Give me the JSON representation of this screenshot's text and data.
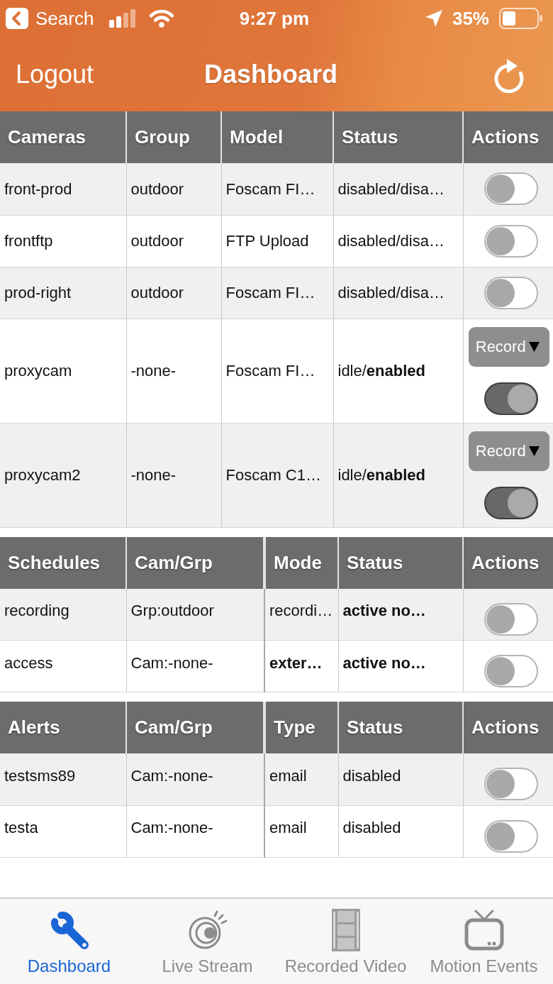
{
  "status_bar": {
    "back_label": "Search",
    "time": "9:27 pm",
    "battery": "35%"
  },
  "nav_bar": {
    "left_button": "Logout",
    "title": "Dashboard"
  },
  "tables": [
    {
      "kind": "cameras",
      "columns": [
        "Cameras",
        "Group",
        "Model",
        "Status",
        "Actions"
      ],
      "rows": [
        {
          "cells": [
            {
              "text": "front-prod",
              "bold": false
            },
            {
              "text": "outdoor",
              "bold": false
            },
            {
              "text": "Foscam FI…",
              "bold": false
            },
            {
              "text": "disabled/disa…",
              "bold": false
            }
          ],
          "on": false
        },
        {
          "cells": [
            {
              "text": "frontftp",
              "bold": false
            },
            {
              "text": "outdoor",
              "bold": false
            },
            {
              "text": "FTP Upload",
              "bold": false
            },
            {
              "text": "disabled/disa…",
              "bold": false
            }
          ],
          "on": false
        },
        {
          "cells": [
            {
              "text": "prod-right",
              "bold": false
            },
            {
              "text": "outdoor",
              "bold": false
            },
            {
              "text": "Foscam FI…",
              "bold": false
            },
            {
              "text": "disabled/disa…",
              "bold": false
            }
          ],
          "on": false
        },
        {
          "cells": [
            {
              "text": "proxycam",
              "bold": false
            },
            {
              "text": "-none-",
              "bold": false
            },
            {
              "text": "Foscam FI…",
              "bold": false
            },
            {
              "text": "idle/**enabled**",
              "bold": false
            }
          ],
          "record_button": "Record",
          "on": true
        },
        {
          "cells": [
            {
              "text": "proxycam2",
              "bold": false
            },
            {
              "text": "-none-",
              "bold": false
            },
            {
              "text": "Foscam C1…",
              "bold": false
            },
            {
              "text": "idle/**enabled**",
              "bold": false
            }
          ],
          "record_button": "Record",
          "on": true
        }
      ]
    },
    {
      "kind": "schedules",
      "columns": [
        "Schedules",
        "Cam/Grp",
        "Mode",
        "Status",
        "Actions"
      ],
      "rows": [
        {
          "cells": [
            {
              "text": "recording",
              "bold": false
            },
            {
              "text": "Grp:outdoor",
              "bold": false
            },
            {
              "text": "recordi…",
              "bold": false
            },
            {
              "text": "active no…",
              "bold": true
            }
          ],
          "on": false
        },
        {
          "cells": [
            {
              "text": "access",
              "bold": false
            },
            {
              "text": "Cam:-none-",
              "bold": false
            },
            {
              "text": "exter…",
              "bold": true
            },
            {
              "text": "active no…",
              "bold": true
            }
          ],
          "on": false
        }
      ]
    },
    {
      "kind": "alerts",
      "columns": [
        "Alerts",
        "Cam/Grp",
        "Type",
        "Status",
        "Actions"
      ],
      "rows": [
        {
          "cells": [
            {
              "text": "testsms89",
              "bold": false
            },
            {
              "text": "Cam:-none-",
              "bold": false
            },
            {
              "text": "email",
              "bold": false
            },
            {
              "text": "disabled",
              "bold": false
            }
          ],
          "on": false
        },
        {
          "cells": [
            {
              "text": "testa",
              "bold": false
            },
            {
              "text": "Cam:-none-",
              "bold": false
            },
            {
              "text": "email",
              "bold": false
            },
            {
              "text": "disabled",
              "bold": false
            }
          ],
          "on": false
        }
      ]
    }
  ],
  "tab_bar": [
    {
      "label": "Dashboard",
      "selected": true
    },
    {
      "label": "Live Stream",
      "selected": false
    },
    {
      "label": "Recorded Video",
      "selected": false
    },
    {
      "label": "Motion Events",
      "selected": false
    }
  ]
}
